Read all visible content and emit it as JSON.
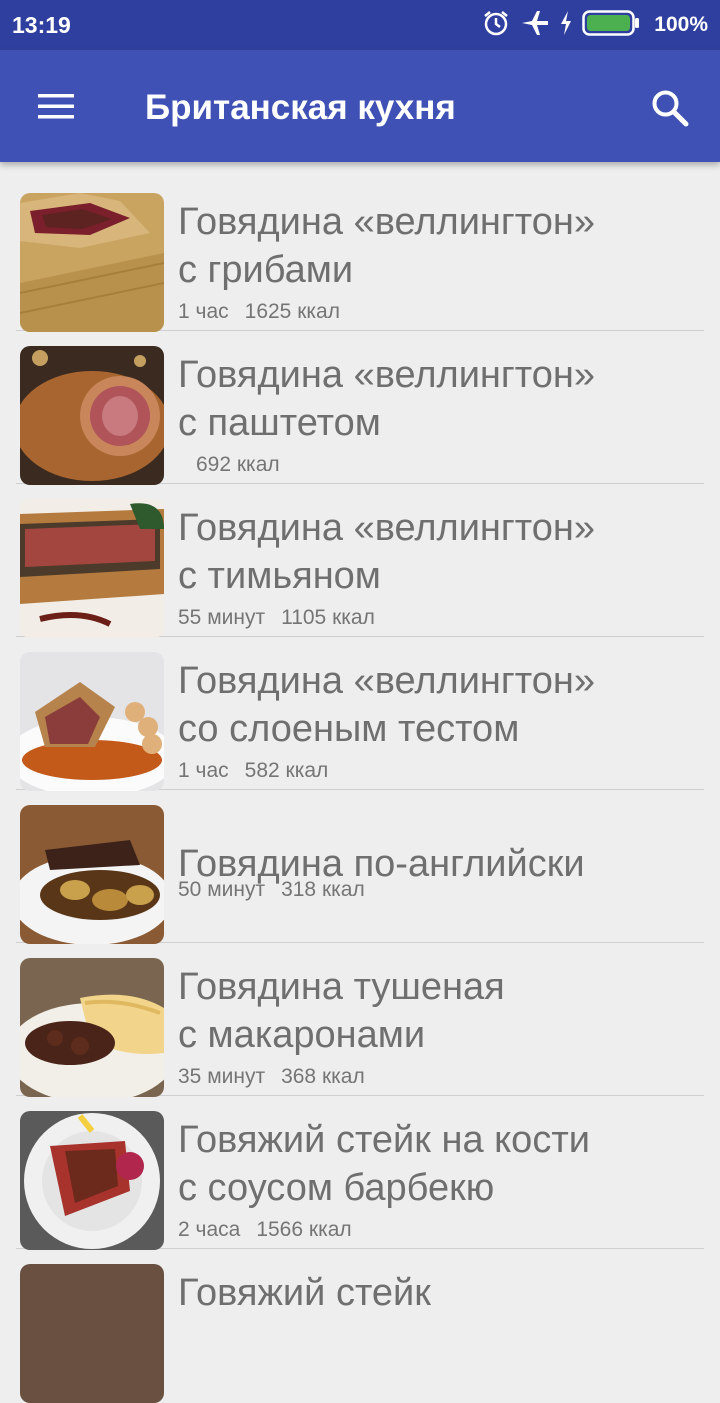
{
  "status_bar": {
    "time": "13:19",
    "battery": "100%",
    "icons": [
      "alarm-icon",
      "airplane-icon",
      "charging-icon",
      "battery-icon"
    ]
  },
  "app_bar": {
    "title": "Британская кухня",
    "menu_icon": "menu-icon",
    "search_icon": "search-icon"
  },
  "colors": {
    "status_bar": "#2f3f9f",
    "app_bar": "#3f51b5",
    "background": "#eeeeee",
    "battery": "#4caf50"
  },
  "recipes": [
    {
      "name_line1": "Говядина «веллингтон»",
      "name_line2": "с грибами",
      "time": "1 час",
      "calories": "1625 ккал"
    },
    {
      "name_line1": "Говядина «веллингтон»",
      "name_line2": "с паштетом",
      "time": "",
      "calories": "692 ккал"
    },
    {
      "name_line1": "Говядина «веллингтон»",
      "name_line2": "с тимьяном",
      "time": "55 минут",
      "calories": "1105 ккал"
    },
    {
      "name_line1": "Говядина «веллингтон»",
      "name_line2": "со слоеным тестом",
      "time": "1 час",
      "calories": "582 ккал"
    },
    {
      "name_line1": "Говядина по-английски",
      "name_line2": "",
      "time": "50 минут",
      "calories": "318 ккал"
    },
    {
      "name_line1": "Говядина тушеная",
      "name_line2": "с макаронами",
      "time": "35 минут",
      "calories": "368 ккал"
    },
    {
      "name_line1": "Говяжий стейк на кости",
      "name_line2": "с соусом барбекю",
      "time": "2 часа",
      "calories": "1566 ккал"
    },
    {
      "name_line1": "Говяжий стейк",
      "name_line2": "",
      "time": "",
      "calories": ""
    }
  ]
}
